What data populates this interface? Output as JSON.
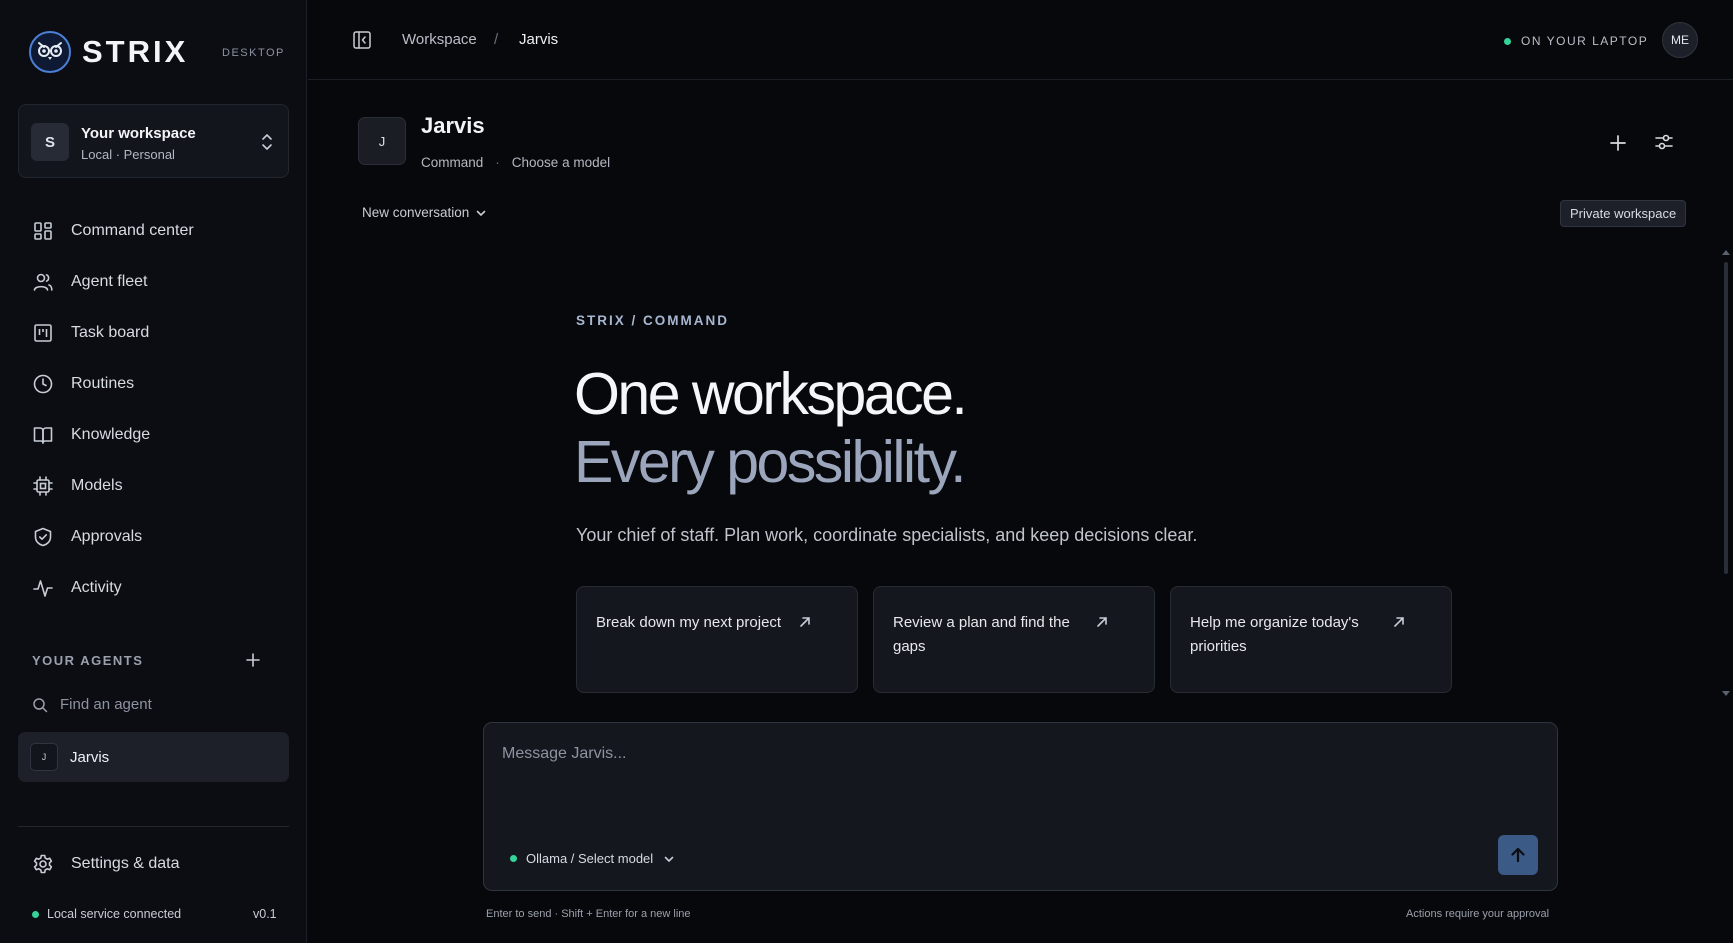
{
  "brand": {
    "name": "STRIX",
    "tag": "DESKTOP"
  },
  "workspace_switcher": {
    "avatar": "S",
    "name": "Your workspace",
    "subtitle": "Local · Personal"
  },
  "nav": {
    "items": [
      {
        "label": "Command center",
        "icon": "grid-icon"
      },
      {
        "label": "Agent fleet",
        "icon": "users-icon"
      },
      {
        "label": "Task board",
        "icon": "kanban-icon"
      },
      {
        "label": "Routines",
        "icon": "clock-icon"
      },
      {
        "label": "Knowledge",
        "icon": "book-icon"
      },
      {
        "label": "Models",
        "icon": "chip-icon"
      },
      {
        "label": "Approvals",
        "icon": "shield-check-icon"
      },
      {
        "label": "Activity",
        "icon": "pulse-icon"
      }
    ]
  },
  "agents": {
    "heading": "YOUR AGENTS",
    "search_placeholder": "Find an agent",
    "list": [
      {
        "avatar": "J",
        "name": "Jarvis"
      }
    ]
  },
  "footer": {
    "settings_label": "Settings & data",
    "service_status": "Local service connected",
    "version": "v0.1"
  },
  "topbar": {
    "breadcrumb": [
      "Workspace",
      "/",
      "Jarvis"
    ],
    "location_status": "ON YOUR LAPTOP",
    "user_initials": "ME"
  },
  "agent_header": {
    "avatar": "J",
    "title": "Jarvis",
    "mode": "Command",
    "separator": "·",
    "model": "Choose a model"
  },
  "conversation": {
    "selector_label": "New conversation",
    "privacy_badge": "Private workspace"
  },
  "hero": {
    "eyebrow": "STRIX / COMMAND",
    "line1": "One workspace.",
    "line2": "Every possibility.",
    "lead": "Your chief of staff. Plan work, coordinate specialists, and keep decisions clear."
  },
  "suggestions": [
    {
      "text": "Break down my next project"
    },
    {
      "text": "Review a plan and find the gaps"
    },
    {
      "text": "Help me organize today's priorities"
    }
  ],
  "composer": {
    "placeholder": "Message Jarvis...",
    "value": "",
    "model_label": "Ollama / Select model",
    "hint_left": "Enter to send · Shift + Enter for a new line",
    "hint_right": "Actions require your approval"
  },
  "colors": {
    "background": "#07080b",
    "sidebar": "#0b0d12",
    "status_green": "#34d399",
    "send_button": "#3b5a86",
    "hero_secondary": "#9ba6bd"
  }
}
